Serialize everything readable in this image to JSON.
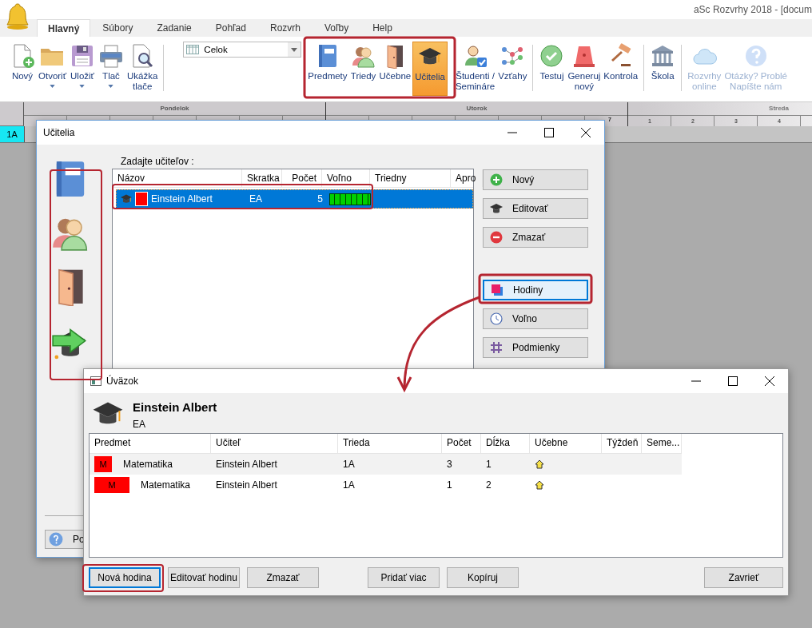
{
  "app": {
    "title": "aSc Rozvrhy 2018  - [docum"
  },
  "tabs": [
    {
      "label": "Hlavný",
      "selected": true
    },
    {
      "label": "Súbory",
      "selected": false
    },
    {
      "label": "Zadanie",
      "selected": false
    },
    {
      "label": "Pohľad",
      "selected": false
    },
    {
      "label": "Rozvrh",
      "selected": false
    },
    {
      "label": "Voľby",
      "selected": false
    },
    {
      "label": "Help",
      "selected": false
    }
  ],
  "ribbon": {
    "items": [
      {
        "kind": "button",
        "lines": [
          "Nový"
        ],
        "menu": false,
        "selected": false,
        "disabled": false
      },
      {
        "kind": "button",
        "lines": [
          "Otvoriť"
        ],
        "menu": true,
        "selected": false,
        "disabled": false
      },
      {
        "kind": "button",
        "lines": [
          "Uložiť"
        ],
        "menu": true,
        "selected": false,
        "disabled": false
      },
      {
        "kind": "button",
        "lines": [
          "Tlač"
        ],
        "menu": true,
        "selected": false,
        "disabled": false
      },
      {
        "kind": "button",
        "lines": [
          "Ukážka",
          "tlače"
        ],
        "menu": false,
        "selected": false,
        "disabled": false
      },
      {
        "kind": "separator"
      },
      {
        "kind": "combo",
        "value": "Celok"
      },
      {
        "kind": "button",
        "lines": [
          "Predmety"
        ],
        "menu": false,
        "selected": false,
        "disabled": false
      },
      {
        "kind": "button",
        "lines": [
          "Triedy"
        ],
        "menu": false,
        "selected": false,
        "disabled": false
      },
      {
        "kind": "button",
        "lines": [
          "Učebne"
        ],
        "menu": false,
        "selected": false,
        "disabled": false
      },
      {
        "kind": "button",
        "lines": [
          "Učitelia"
        ],
        "menu": false,
        "selected": true,
        "disabled": false
      },
      {
        "kind": "button",
        "lines": [
          "Študenti /",
          "Semináre"
        ],
        "menu": false,
        "selected": false,
        "disabled": false
      },
      {
        "kind": "button",
        "lines": [
          "Vzťahy"
        ],
        "menu": false,
        "selected": false,
        "disabled": false
      },
      {
        "kind": "separator"
      },
      {
        "kind": "button",
        "lines": [
          "Testuj"
        ],
        "menu": false,
        "selected": false,
        "disabled": false
      },
      {
        "kind": "button",
        "lines": [
          "Generuj",
          "nový"
        ],
        "menu": false,
        "selected": false,
        "disabled": false
      },
      {
        "kind": "button",
        "lines": [
          "Kontrola"
        ],
        "menu": false,
        "selected": false,
        "disabled": false
      },
      {
        "kind": "separator"
      },
      {
        "kind": "button",
        "lines": [
          "Škola"
        ],
        "menu": false,
        "selected": false,
        "disabled": false
      },
      {
        "kind": "separator"
      },
      {
        "kind": "button",
        "lines": [
          "Rozvrhy",
          "online"
        ],
        "menu": false,
        "selected": false,
        "disabled": true
      },
      {
        "kind": "button",
        "lines": [
          "Otázky? Problé",
          "Napíšte nám"
        ],
        "menu": false,
        "selected": false,
        "disabled": true
      }
    ]
  },
  "timetable": {
    "days": [
      {
        "name": "Pondelok"
      },
      {
        "name": "Utorok",
        "periods": [
          "7"
        ]
      },
      {
        "name": "Streda",
        "periods": [
          "1",
          "2",
          "3",
          "4"
        ]
      }
    ],
    "classes": [
      "1A"
    ]
  },
  "teachers_dialog": {
    "title": "Učitelia",
    "prompt": "Zadajte učiteľov :",
    "columns": [
      "Názov",
      "Skratka",
      "Počet",
      "Voľno",
      "Triedny",
      "Apro"
    ],
    "rows": [
      {
        "name": "Einstein Albert",
        "short": "EA",
        "count": "5",
        "color": "#ff0000",
        "selected": true
      }
    ],
    "buttons": [
      {
        "label": "Nový",
        "highlighted": false
      },
      {
        "label": "Editovať",
        "highlighted": false
      },
      {
        "label": "Zmazať",
        "highlighted": false
      },
      {
        "label": "Hodiny",
        "highlighted": true
      },
      {
        "label": "Voľno",
        "highlighted": false
      },
      {
        "label": "Podmienky",
        "highlighted": false
      }
    ],
    "help_button": "Po"
  },
  "load_dialog": {
    "title": "Úväzok",
    "teacher": "Einstein Albert",
    "short": "EA",
    "columns": [
      "Predmet",
      "Učiteľ",
      "Trieda",
      "Počet",
      "Dĺžka",
      "Učebne",
      "Týždeň",
      "Seme..."
    ],
    "rows": [
      {
        "tag": "M",
        "color": "#ff0000",
        "subject": "Matematika",
        "teacher": "Einstein Albert",
        "class": "1A",
        "count": "3",
        "length": "1"
      },
      {
        "tag": "M",
        "color": "#ff0000",
        "subject": "Matematika",
        "teacher": "Einstein Albert",
        "class": "1A",
        "count": "1",
        "length": "2"
      }
    ],
    "buttons": [
      {
        "label": "Nová hodina",
        "focused": true
      },
      {
        "label": "Editovať hodinu",
        "focused": false
      },
      {
        "label": "Zmazať",
        "focused": false
      },
      {
        "label": "Pridať viac",
        "focused": false
      },
      {
        "label": "Kopíruj",
        "focused": false
      },
      {
        "label": "Zavrieť",
        "focused": false
      }
    ]
  }
}
